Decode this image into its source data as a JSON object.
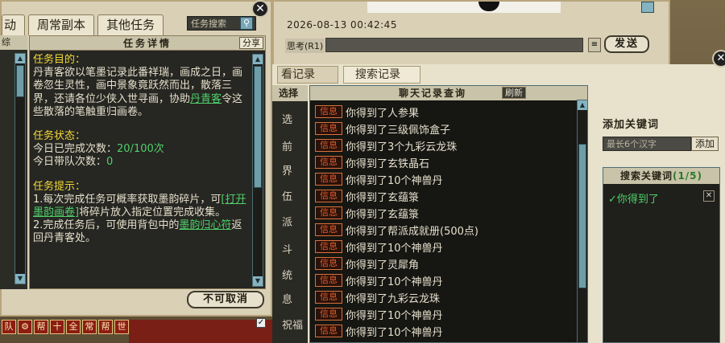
{
  "quest": {
    "tabs": [
      "动",
      "周常副本",
      "其他任务"
    ],
    "search_placeholder": "任务搜索",
    "left_strip_head": "综",
    "detail_title": "任务详情",
    "share_label": "分享",
    "purpose_heading": "任务目的：",
    "purpose_text_a": "丹青客欲以笔墨记录此番祥瑞，画成之日，画卷忽生灵性，画中景象竟跃然而出，散落三界，还请各位少侠入世寻画，协助",
    "purpose_link": "丹青客",
    "purpose_text_b": "令这些散落的笔触重归画卷。",
    "status_heading": "任务状态：",
    "status_done_label": "今日已完成次数：",
    "status_done_value": "20/100次",
    "status_team_label": "今日带队次数：",
    "status_team_value": "0",
    "hint_heading": "任务提示：",
    "hint_1a": "1.每次完成任务可概率获取墨韵碎片，可",
    "hint_1_link": "[打开墨韵画卷]",
    "hint_1b": "将碎片放入指定位置完成收集。",
    "hint_2a": "2.完成任务后，可使用背包中的",
    "hint_2_item": "墨韵归心符",
    "hint_2b": "返回丹青客处。",
    "cancel_label": "不可取消",
    "bottom_icons": [
      "队",
      "⚙",
      "帮",
      "十",
      "全",
      "常",
      "帮",
      "世"
    ]
  },
  "chat": {
    "timestamp": "2026-08-13  00:42:45",
    "think_label": "思考(R1)",
    "send_label": "发送",
    "tab_records": "看记录",
    "tab_search": "搜索记录",
    "side_head": "选择",
    "side_items": [
      "选",
      "前",
      "界",
      "伍",
      "派",
      "斗",
      "统",
      "息",
      "祝福"
    ],
    "list_title": "聊天记录查询",
    "refresh_label": "刷新",
    "messages": [
      {
        "tag": "信息",
        "text": "你得到了人参果"
      },
      {
        "tag": "信息",
        "text": "你得到了三级佩饰盒子"
      },
      {
        "tag": "信息",
        "text": "你得到了3个九彩云龙珠"
      },
      {
        "tag": "信息",
        "text": "你得到了玄铁晶石"
      },
      {
        "tag": "信息",
        "text": "你得到了10个神兽丹"
      },
      {
        "tag": "信息",
        "text": "你得到了玄蕴箓"
      },
      {
        "tag": "信息",
        "text": "你得到了玄蕴箓"
      },
      {
        "tag": "信息",
        "text": "你得到了帮派成就册(500点)"
      },
      {
        "tag": "信息",
        "text": "你得到了10个神兽丹"
      },
      {
        "tag": "信息",
        "text": "你得到了灵犀角"
      },
      {
        "tag": "信息",
        "text": "你得到了10个神兽丹"
      },
      {
        "tag": "信息",
        "text": "你得到了九彩云龙珠"
      },
      {
        "tag": "信息",
        "text": "你得到了10个神兽丹"
      },
      {
        "tag": "信息",
        "text": "你得到了10个神兽丹"
      }
    ]
  },
  "keywords": {
    "title": "添加关键词",
    "input_placeholder": "最长6个汉字",
    "add_label": "添加",
    "box_title": "搜索关键词",
    "count": "(1/5)",
    "items": [
      "✓你得到了"
    ]
  }
}
